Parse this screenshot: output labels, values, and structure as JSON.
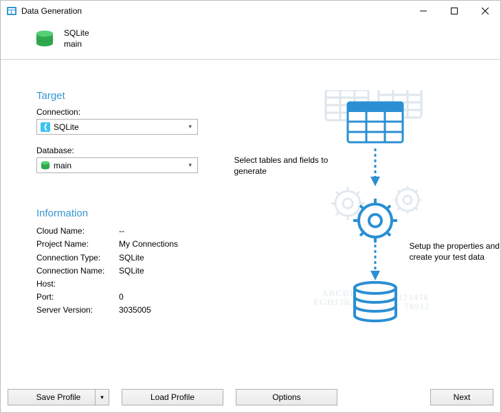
{
  "window": {
    "title": "Data Generation"
  },
  "header": {
    "line1": "SQLite",
    "line2": "main"
  },
  "target": {
    "heading": "Target",
    "connection_label": "Connection:",
    "connection_value": "SQLite",
    "database_label": "Database:",
    "database_value": "main"
  },
  "info": {
    "heading": "Information",
    "rows": {
      "cloud_name_label": "Cloud Name:",
      "cloud_name_value": "--",
      "project_name_label": "Project Name:",
      "project_name_value": "My Connections",
      "conn_type_label": "Connection Type:",
      "conn_type_value": "SQLite",
      "conn_name_label": "Connection Name:",
      "conn_name_value": "SQLite",
      "host_label": "Host:",
      "host_value": "",
      "port_label": "Port:",
      "port_value": "0",
      "server_ver_label": "Server Version:",
      "server_ver_value": "3035005"
    }
  },
  "diagram": {
    "caption1": "Select tables and fields to generate",
    "caption2": "Setup the properties and create your test data",
    "bg_text1": "ABCDE",
    "bg_text2": "FGHIJKL",
    "bg_text3": "123456",
    "bg_text4": "78912"
  },
  "buttons": {
    "save_profile": "Save Profile",
    "load_profile": "Load Profile",
    "options": "Options",
    "next": "Next"
  }
}
